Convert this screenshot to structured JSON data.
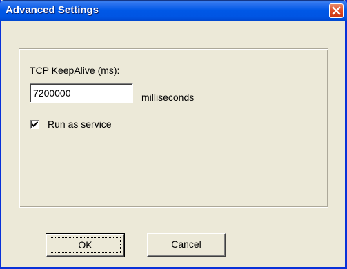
{
  "dialog": {
    "title": "Advanced Settings"
  },
  "settings": {
    "keepalive_label": "TCP KeepAlive (ms):",
    "keepalive_value": "7200000",
    "keepalive_unit": "milliseconds",
    "run_as_service_label": "Run as service",
    "run_as_service_checked": true
  },
  "buttons": {
    "ok_label": "OK",
    "cancel_label": "Cancel"
  },
  "colors": {
    "titlebar": "#0054E3",
    "dialog_background": "#ECE9D8",
    "close_button": "#E0502A"
  },
  "icons": {
    "close": "close-icon",
    "check": "checkmark-icon"
  }
}
